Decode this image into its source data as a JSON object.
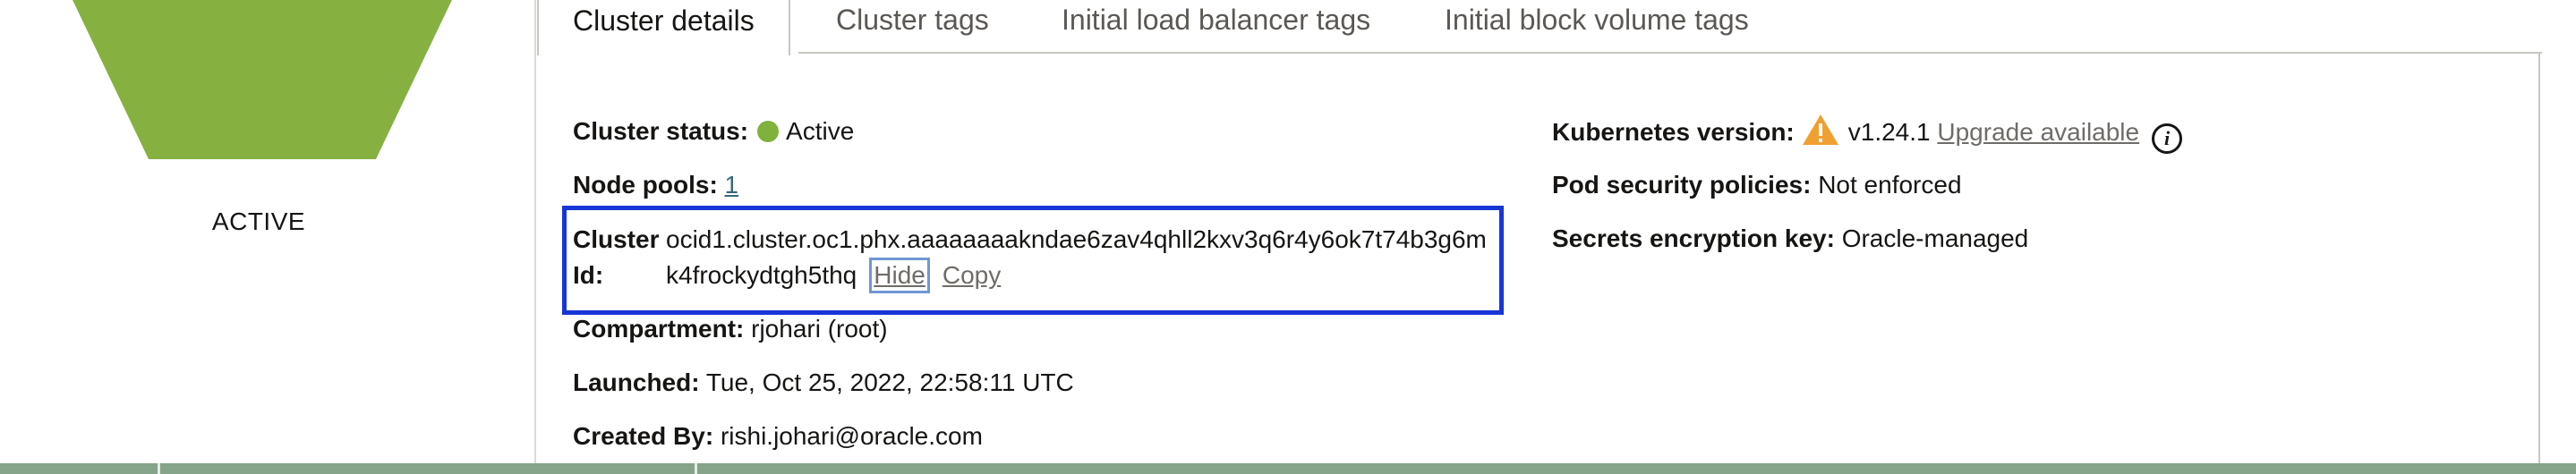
{
  "status_panel": {
    "state": "ACTIVE",
    "colors": {
      "hexagon": "#86B140"
    }
  },
  "tabs": [
    {
      "label": "Cluster details",
      "active": true
    },
    {
      "label": "Cluster tags",
      "active": false
    },
    {
      "label": "Initial load balancer tags",
      "active": false
    },
    {
      "label": "Initial block volume tags",
      "active": false
    }
  ],
  "details": {
    "cluster_status": {
      "label": "Cluster status:",
      "value": "Active",
      "color": "#7FB23C"
    },
    "node_pools": {
      "label": "Node pools:",
      "value": "1"
    },
    "cluster_id": {
      "label": "Cluster Id:",
      "value": "ocid1.cluster.oc1.phx.aaaaaaaakndae6zav4qhll2kxv3q6r4y6ok7t74b3g6mk4frockydtgh5thq",
      "hide_label": "Hide",
      "copy_label": "Copy"
    },
    "compartment": {
      "label": "Compartment:",
      "value": "rjohari (root)"
    },
    "launched": {
      "label": "Launched:",
      "value": "Tue, Oct 25, 2022, 22:58:11 UTC"
    },
    "created_by": {
      "label": "Created By:",
      "value": "rishi.johari@oracle.com"
    },
    "kubernetes_version": {
      "label": "Kubernetes version:",
      "value": "v1.24.1",
      "upgrade_label": "Upgrade available",
      "icons": [
        "warning-icon",
        "info-icon"
      ]
    },
    "pod_security": {
      "label": "Pod security policies:",
      "value": "Not enforced"
    },
    "secrets_key": {
      "label": "Secrets encryption key:",
      "value": "Oracle-managed"
    }
  },
  "colors": {
    "highlight_border": "#1636D6",
    "link": "#36677D",
    "warning": "#F0A030",
    "bottom_bar": "#85A489"
  }
}
